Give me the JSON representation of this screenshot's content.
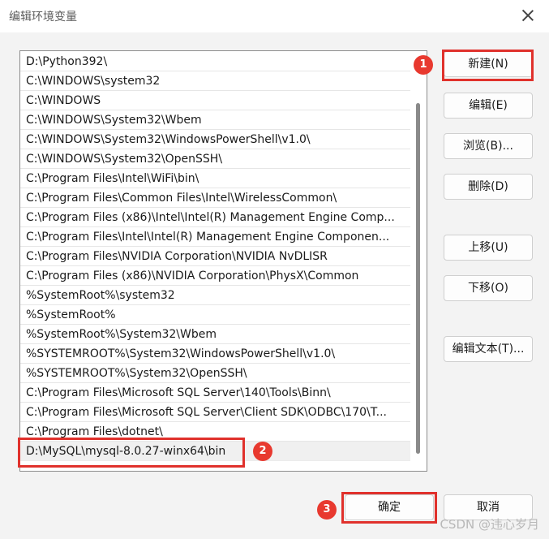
{
  "dialog": {
    "title": "编辑环境变量",
    "close_label": "×"
  },
  "paths": [
    "D:\\Python392\\",
    "C:\\WINDOWS\\system32",
    "C:\\WINDOWS",
    "C:\\WINDOWS\\System32\\Wbem",
    "C:\\WINDOWS\\System32\\WindowsPowerShell\\v1.0\\",
    "C:\\WINDOWS\\System32\\OpenSSH\\",
    "C:\\Program Files\\Intel\\WiFi\\bin\\",
    "C:\\Program Files\\Common Files\\Intel\\WirelessCommon\\",
    "C:\\Program Files (x86)\\Intel\\Intel(R) Management Engine Comp...",
    "C:\\Program Files\\Intel\\Intel(R) Management Engine Componen...",
    "C:\\Program Files\\NVIDIA Corporation\\NVIDIA NvDLISR",
    "C:\\Program Files (x86)\\NVIDIA Corporation\\PhysX\\Common",
    "%SystemRoot%\\system32",
    "%SystemRoot%",
    "%SystemRoot%\\System32\\Wbem",
    "%SYSTEMROOT%\\System32\\WindowsPowerShell\\v1.0\\",
    "%SYSTEMROOT%\\System32\\OpenSSH\\",
    "C:\\Program Files\\Microsoft SQL Server\\140\\Tools\\Binn\\",
    "C:\\Program Files\\Microsoft SQL Server\\Client SDK\\ODBC\\170\\T...",
    "C:\\Program Files\\dotnet\\",
    "D:\\MySQL\\mysql-8.0.27-winx64\\bin"
  ],
  "buttons": {
    "new": "新建(N)",
    "edit": "编辑(E)",
    "browse": "浏览(B)...",
    "delete": "删除(D)",
    "move_up": "上移(U)",
    "move_down": "下移(O)",
    "edit_text": "编辑文本(T)...",
    "ok": "确定",
    "cancel": "取消"
  },
  "annotations": {
    "badge1": "1",
    "badge2": "2",
    "badge3": "3"
  },
  "watermark": "CSDN @违心岁月",
  "colors": {
    "annotation_red": "#e0312c",
    "selected_row": "#f0f0f0"
  }
}
